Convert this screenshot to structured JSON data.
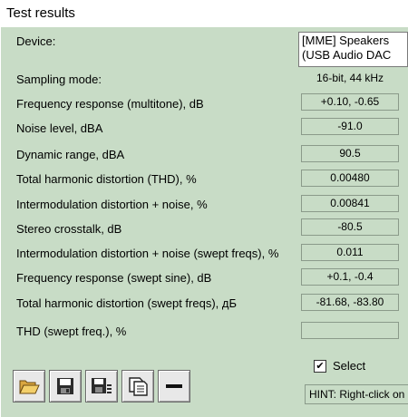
{
  "window": {
    "title": "Test results"
  },
  "device": {
    "label": "Device:",
    "value_line1": "[MME] Speakers",
    "value_line2": "(USB Audio DAC"
  },
  "rows": [
    {
      "label": "Sampling mode:",
      "value": "16-bit, 44 kHz"
    },
    {
      "label": "Frequency response (multitone), dB",
      "value": "+0.10, -0.65"
    },
    {
      "label": "Noise level, dBA",
      "value": "-91.0"
    },
    {
      "label": "Dynamic range, dBA",
      "value": "90.5"
    },
    {
      "label": "Total harmonic distortion (THD), %",
      "value": "0.00480"
    },
    {
      "label": "Intermodulation distortion + noise, %",
      "value": "0.00841"
    },
    {
      "label": "Stereo crosstalk, dB",
      "value": "-80.5"
    },
    {
      "label": "Intermodulation distortion + noise (swept freqs), %",
      "value": "0.011"
    },
    {
      "label": "Frequency response (swept sine), dB",
      "value": "+0.1, -0.4"
    },
    {
      "label": "Total harmonic distortion (swept freqs), дБ",
      "value": "-81.68, -83.80"
    },
    {
      "label": "THD (swept freq.), %",
      "value": ""
    }
  ],
  "toolbar": {
    "buttons": [
      {
        "icon": "open-folder-icon"
      },
      {
        "icon": "save-icon"
      },
      {
        "icon": "save-report-icon"
      },
      {
        "icon": "copy-icon"
      },
      {
        "icon": "minus-icon"
      }
    ]
  },
  "select": {
    "label": "Select",
    "checked": true,
    "check_glyph": "✔"
  },
  "hint": {
    "text": "HINT: Right-click on"
  }
}
